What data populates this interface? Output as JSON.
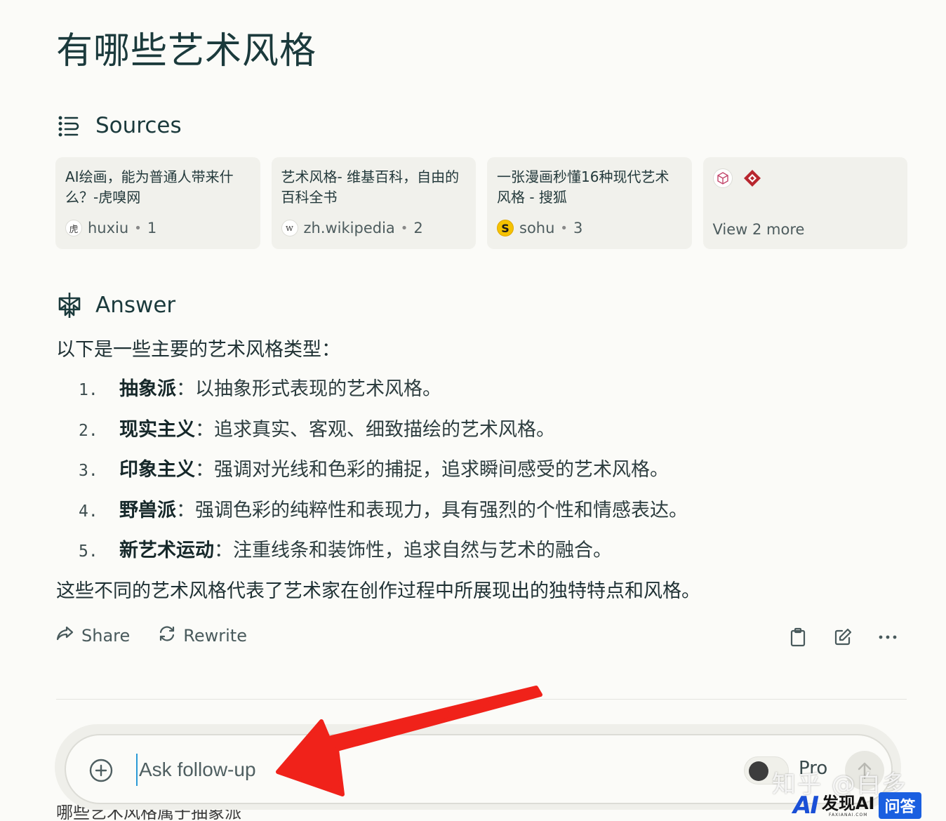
{
  "query_title": "有哪些艺术风格",
  "sources": {
    "heading": "Sources",
    "cards": [
      {
        "title": "AI绘画，能为普通人带来什么？-虎嗅网",
        "site": "huxiu",
        "index": "1",
        "favicon": "虎"
      },
      {
        "title": "艺术风格- 维基百科，自由的百科全书",
        "site": "zh.wikipedia",
        "index": "2",
        "favicon": "w"
      },
      {
        "title": "一张漫画秒懂16种现代艺术风格 - 搜狐",
        "site": "sohu",
        "index": "3",
        "favicon": "S"
      }
    ],
    "view_more": "View 2 more"
  },
  "answer": {
    "heading": "Answer",
    "intro": "以下是一些主要的艺术风格类型：",
    "items": [
      {
        "num": "1.",
        "term": "抽象派",
        "desc": "以抽象形式表现的艺术风格。"
      },
      {
        "num": "2.",
        "term": "现实主义",
        "desc": "追求真实、客观、细致描绘的艺术风格。"
      },
      {
        "num": "3.",
        "term": "印象主义",
        "desc": "强调对光线和色彩的捕捉，追求瞬间感受的艺术风格。"
      },
      {
        "num": "4.",
        "term": "野兽派",
        "desc": "强调色彩的纯粹性和表现力，具有强烈的个性和情感表达。"
      },
      {
        "num": "5.",
        "term": "新艺术运动",
        "desc": "注重线条和装饰性，追求自然与艺术的融合。"
      }
    ],
    "separator": "：",
    "outro": "这些不同的艺术风格代表了艺术家在创作过程中所展现出的独特特点和风格。"
  },
  "actions": {
    "share": "Share",
    "rewrite": "Rewrite"
  },
  "ask": {
    "placeholder": "Ask follow-up",
    "pro_label": "Pro"
  },
  "next_query_peek": "哪些艺术风格属于抽象派",
  "watermark": "知乎 @白多",
  "logo": {
    "ai": "AI",
    "cn": "发现AI",
    "domain": "FAXIANAI.COM",
    "badge": "问答"
  },
  "colors": {
    "background": "#fbfbf8",
    "text": "#1b3a3c",
    "card": "#f1f1ec",
    "annotation_arrow": "#f0221a"
  }
}
